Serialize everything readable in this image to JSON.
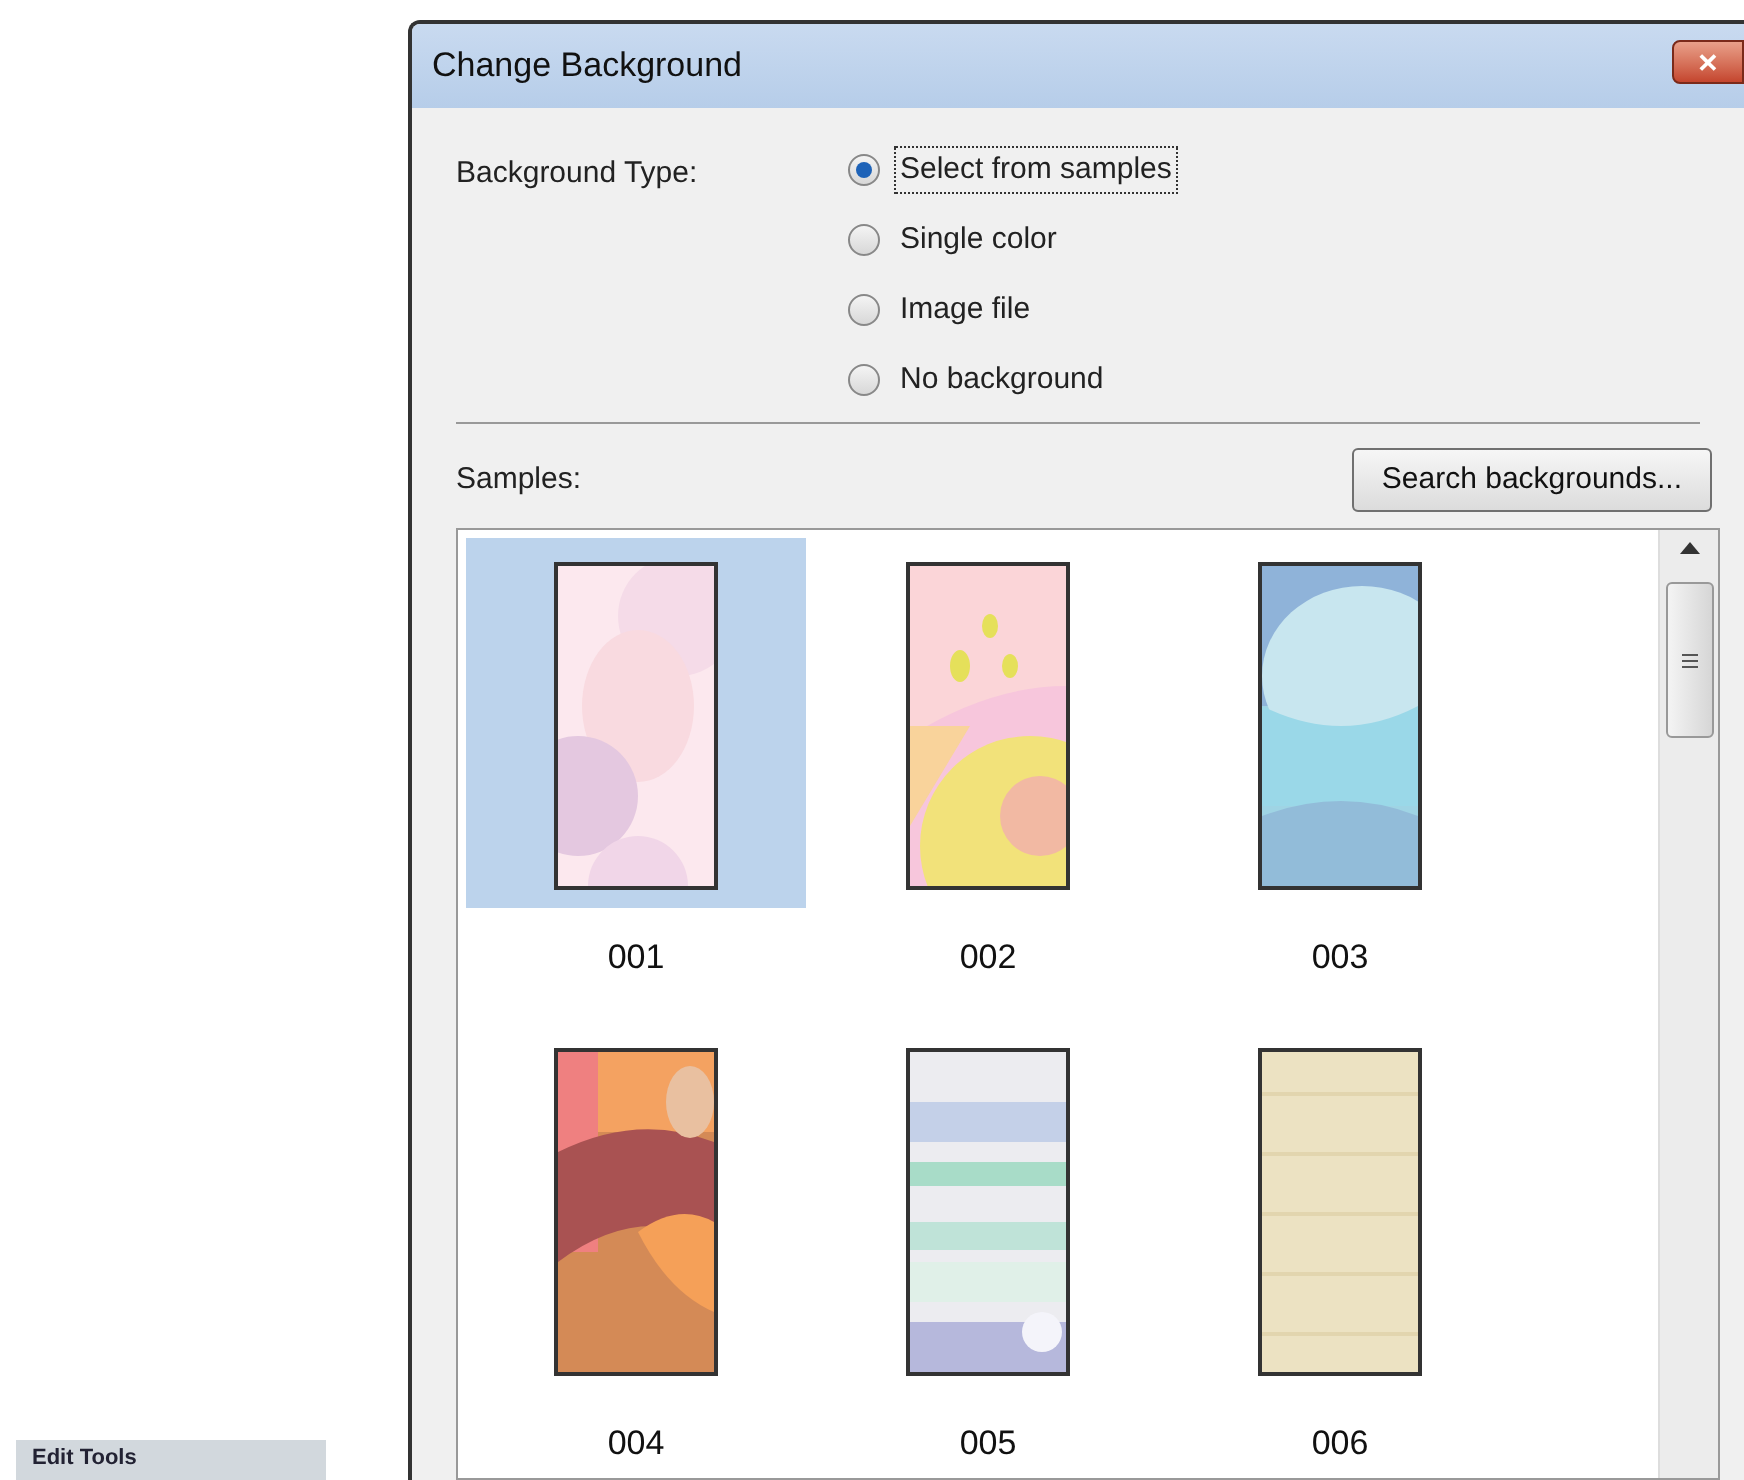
{
  "dialog": {
    "title": "Change Background",
    "close_glyph": "✕",
    "background_type": {
      "label": "Background Type:",
      "options": [
        {
          "label": "Select from samples",
          "selected": true
        },
        {
          "label": "Single color",
          "selected": false
        },
        {
          "label": "Image file",
          "selected": false
        },
        {
          "label": "No background",
          "selected": false
        }
      ]
    },
    "samples": {
      "label": "Samples:",
      "search_button": "Search backgrounds...",
      "items": [
        {
          "label": "001",
          "selected": true
        },
        {
          "label": "002",
          "selected": false
        },
        {
          "label": "003",
          "selected": false
        },
        {
          "label": "004",
          "selected": false
        },
        {
          "label": "005",
          "selected": false
        },
        {
          "label": "006",
          "selected": false
        }
      ]
    }
  },
  "side_panel": {
    "title": "Edit Tools"
  }
}
